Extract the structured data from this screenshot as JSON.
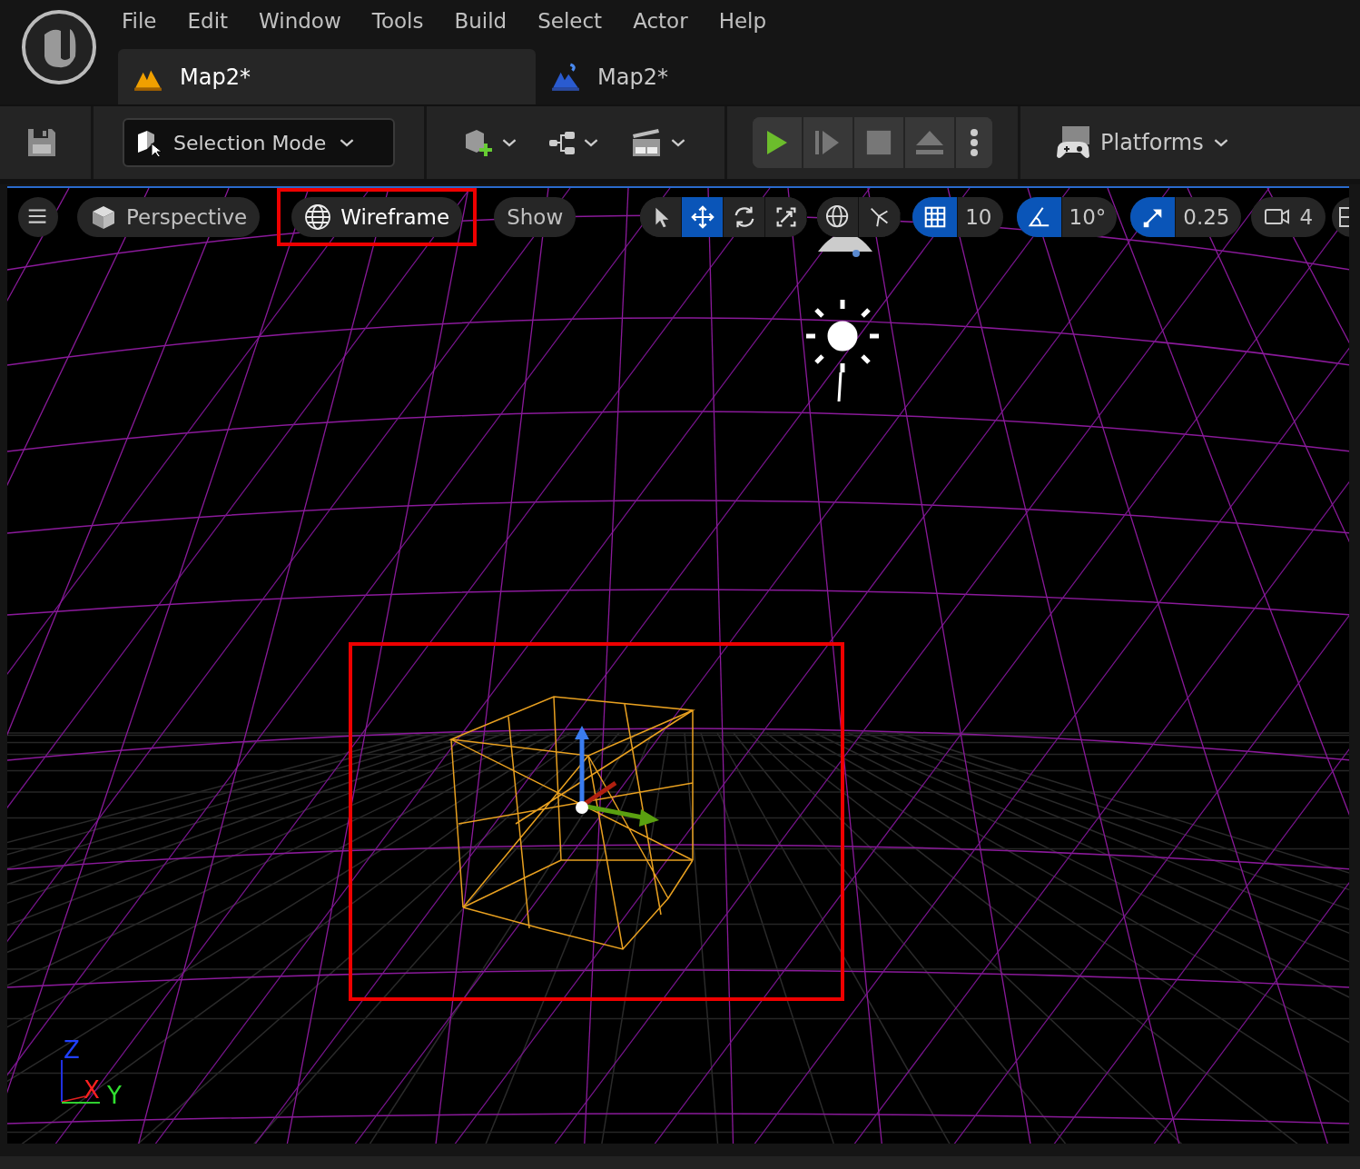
{
  "menu": [
    "File",
    "Edit",
    "Window",
    "Tools",
    "Build",
    "Select",
    "Actor",
    "Help"
  ],
  "tabs": [
    {
      "label": "Map2*",
      "selected": true,
      "kind": "level"
    },
    {
      "label": "Map2*",
      "selected": false,
      "kind": "blueprint"
    }
  ],
  "toolbar": {
    "mode": "Selection Mode",
    "platforms": "Platforms"
  },
  "viewport": {
    "view_options": [
      {
        "label": "Perspective",
        "kind": "perspective",
        "outlined": false
      },
      {
        "label": "Wireframe",
        "kind": "wireframe",
        "outlined": true
      },
      {
        "label": "Show",
        "kind": "plain",
        "outlined": false
      }
    ],
    "transform_tools": [
      {
        "kind": "select",
        "selected": false
      },
      {
        "kind": "move",
        "selected": true
      },
      {
        "kind": "rotate",
        "selected": false
      },
      {
        "kind": "scale",
        "selected": false
      }
    ],
    "snaps": [
      {
        "kind": "grid",
        "value": "10",
        "on": true
      },
      {
        "kind": "angle",
        "value": "10°",
        "on": true
      },
      {
        "kind": "scale",
        "value": "0.25",
        "on": true
      }
    ],
    "camera_speed": "4",
    "selection_frame": true,
    "axis_labels": [
      "Z",
      "X",
      "Y"
    ]
  }
}
